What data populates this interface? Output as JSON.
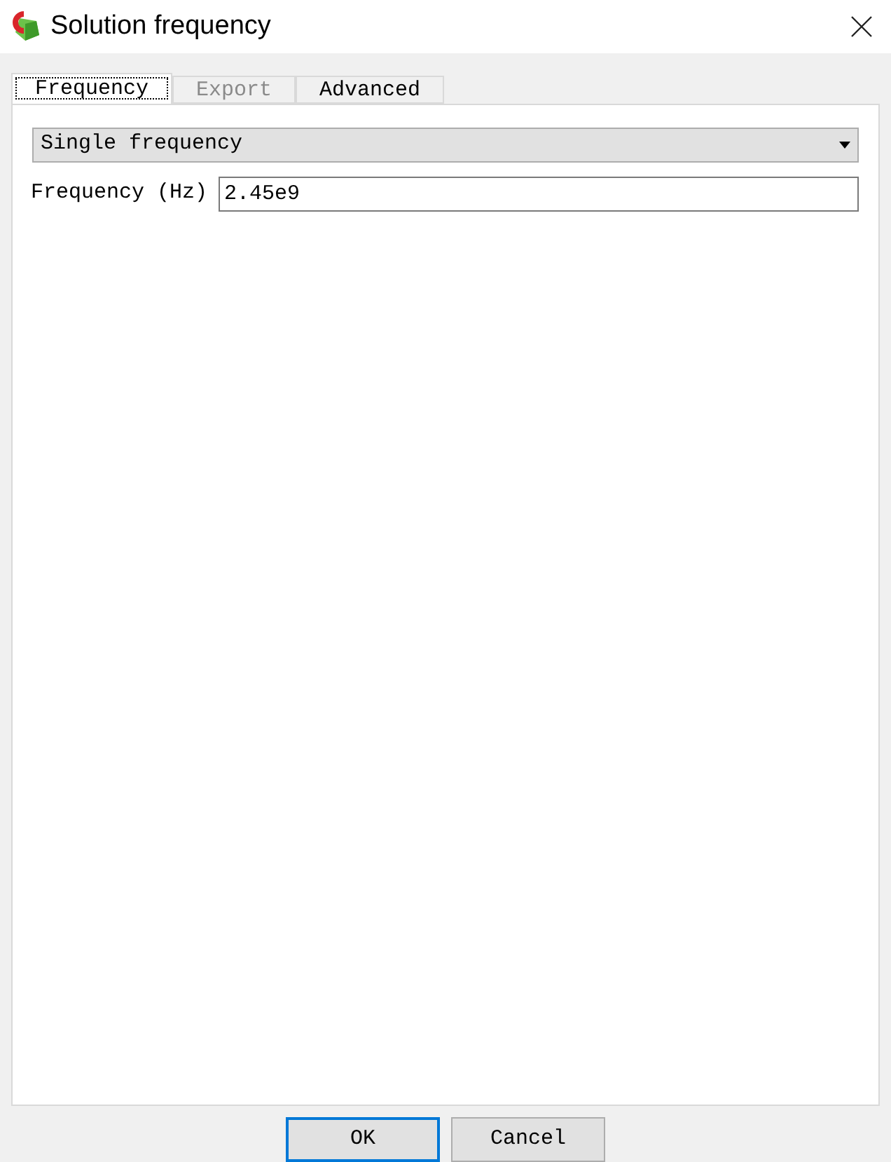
{
  "window": {
    "title": "Solution frequency"
  },
  "tabs": [
    {
      "label": "Frequency",
      "selected": true,
      "disabled": false
    },
    {
      "label": "Export",
      "selected": false,
      "disabled": true
    },
    {
      "label": "Advanced",
      "selected": false,
      "disabled": false
    }
  ],
  "mode_select": {
    "value": "Single frequency"
  },
  "frequency_field": {
    "label": "Frequency (Hz)",
    "value": "2.45e9"
  },
  "buttons": [
    {
      "label": "OK",
      "default": true
    },
    {
      "label": "Cancel",
      "default": false
    }
  ]
}
